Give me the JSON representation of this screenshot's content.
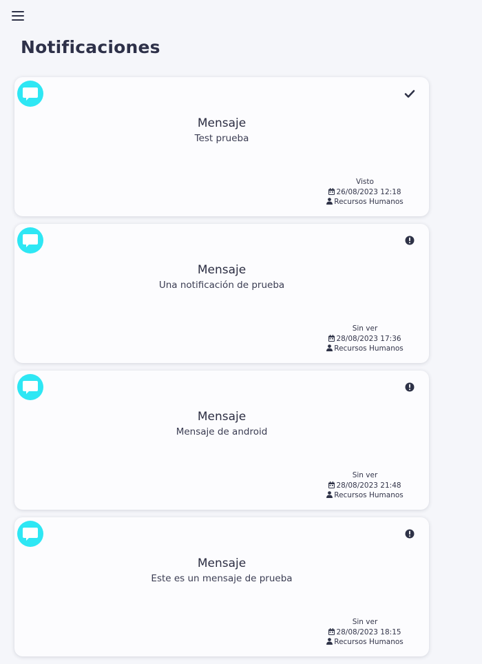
{
  "page": {
    "title": "Notificaciones"
  },
  "colors": {
    "accent": "#2ee7f4",
    "text": "#2b2d42",
    "background": "#f5f6fa",
    "card": "#fcfcfe"
  },
  "notifications": [
    {
      "icon": "chat-bubble-icon",
      "status_icon": "check-icon",
      "title": "Mensaje",
      "message": "Test prueba",
      "status": "Visto",
      "date": "26/08/2023 12:18",
      "sender": "Recursos Humanos"
    },
    {
      "icon": "chat-bubble-icon",
      "status_icon": "exclamation-circle-icon",
      "title": "Mensaje",
      "message": "Una notificación de prueba",
      "status": "Sin ver",
      "date": "28/08/2023 17:36",
      "sender": "Recursos Humanos"
    },
    {
      "icon": "chat-bubble-icon",
      "status_icon": "exclamation-circle-icon",
      "title": "Mensaje",
      "message": "Mensaje de android",
      "status": "Sin ver",
      "date": "28/08/2023 21:48",
      "sender": "Recursos Humanos"
    },
    {
      "icon": "chat-bubble-icon",
      "status_icon": "exclamation-circle-icon",
      "title": "Mensaje",
      "message": "Este es un mensaje de prueba",
      "status": "Sin ver",
      "date": "28/08/2023 18:15",
      "sender": "Recursos Humanos"
    }
  ]
}
